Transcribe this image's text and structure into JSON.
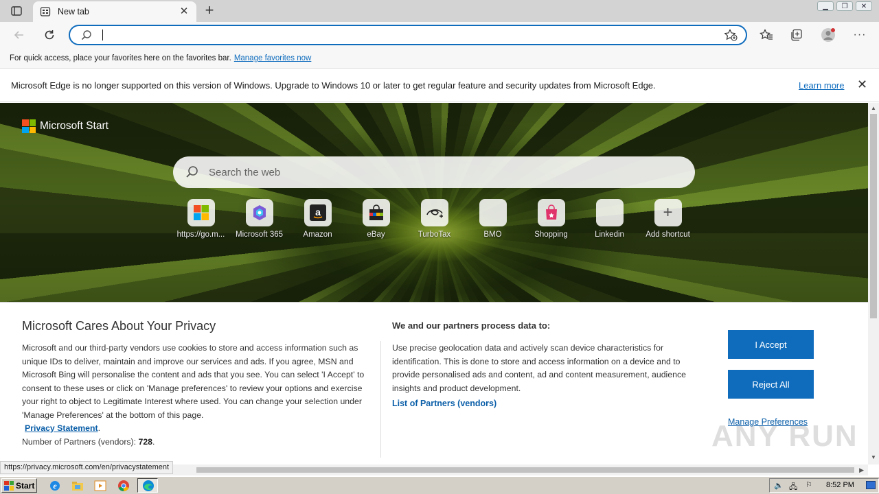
{
  "browser": {
    "tab_title": "New tab",
    "address_value": "",
    "favorites_bar": {
      "text": "For quick access, place your favorites here on the favorites bar.",
      "link": "Manage favorites now"
    },
    "infobar": {
      "text": "Microsoft Edge is no longer supported on this version of Windows. Upgrade to Windows 10 or later to get regular feature and security updates from Microsoft Edge.",
      "link": "Learn more"
    }
  },
  "newtab": {
    "brand": "Microsoft Start",
    "search_placeholder": "Search the web",
    "shortcuts": [
      {
        "label": "https://go.m...",
        "icon": "windows-logo-icon"
      },
      {
        "label": "Microsoft 365",
        "icon": "microsoft-365-icon"
      },
      {
        "label": "Amazon",
        "icon": "amazon-icon"
      },
      {
        "label": "eBay",
        "icon": "ebay-bag-icon"
      },
      {
        "label": "TurboTax",
        "icon": "disney-plus-icon"
      },
      {
        "label": "BMO",
        "icon": "blank-tile-icon"
      },
      {
        "label": "Shopping",
        "icon": "shopping-bag-icon"
      },
      {
        "label": "Linkedin",
        "icon": "blank-tile-icon"
      },
      {
        "label": "Add shortcut",
        "icon": "plus-icon"
      }
    ]
  },
  "privacy": {
    "title": "Microsoft Cares About Your Privacy",
    "body": "Microsoft and our third-party vendors use cookies to store and access information such as unique IDs to deliver, maintain and improve our services and ads. If you agree, MSN and Microsoft Bing will personalise the content and ads that you see. You can select 'I Accept' to consent to these uses or click on 'Manage preferences' to review your options and exercise your right to object to Legitimate Interest where used.  You can change your selection under 'Manage Preferences' at the bottom of this page.",
    "privacy_link": "Privacy Statement",
    "partners_prefix": "Number of Partners (vendors): ",
    "partners_count": "728",
    "right_heading": "We and our partners process data to:",
    "right_body": "Use precise geolocation data and actively scan device characteristics for identification. This is done to store and access information on a device and to provide personalised ads and content, ad and content measurement, audience insights and product development.",
    "partners_link": "List of Partners (vendors)",
    "accept": "I Accept",
    "reject": "Reject All",
    "manage": "Manage Preferences"
  },
  "status_url": "https://privacy.microsoft.com/en/privacystatement",
  "watermark": "ANY RUN",
  "taskbar": {
    "start": "Start",
    "clock": "8:52 PM"
  },
  "colors": {
    "accent": "#0f6cbd",
    "link": "#0a5ea8"
  }
}
